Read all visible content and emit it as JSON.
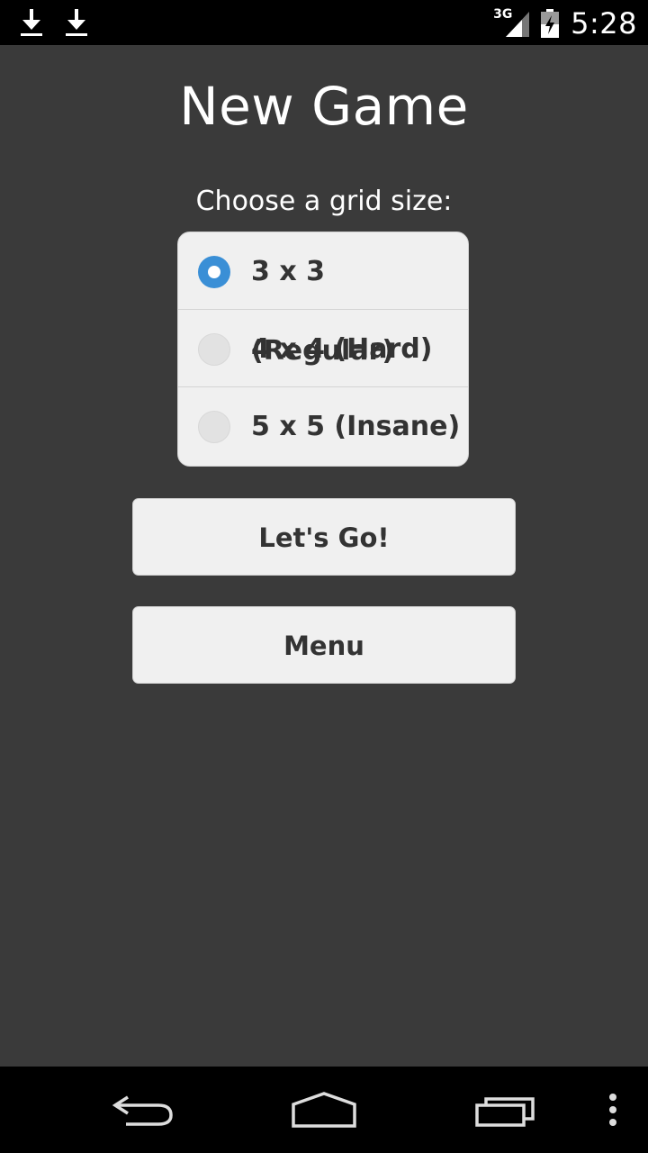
{
  "status_bar": {
    "network_type": "3G",
    "time": "5:28",
    "icons": [
      "download-icon",
      "download-icon",
      "signal-icon",
      "battery-charging-icon"
    ]
  },
  "page": {
    "title": "New Game",
    "prompt": "Choose a grid size:"
  },
  "grid_options": [
    {
      "label": "3 x 3 (Regular)",
      "checked": true
    },
    {
      "label": "4 x 4 (Hard)",
      "checked": false
    },
    {
      "label": "5 x 5 (Insane)",
      "checked": false
    }
  ],
  "buttons": {
    "go_label": "Let's Go!",
    "menu_label": "Menu"
  },
  "nav_bar": {
    "icons": [
      "back-icon",
      "home-icon",
      "recents-icon",
      "overflow-menu-icon"
    ]
  },
  "colors": {
    "background": "#3a3a3a",
    "accent": "#3a8fd6",
    "button_bg": "#f0f0f0"
  }
}
